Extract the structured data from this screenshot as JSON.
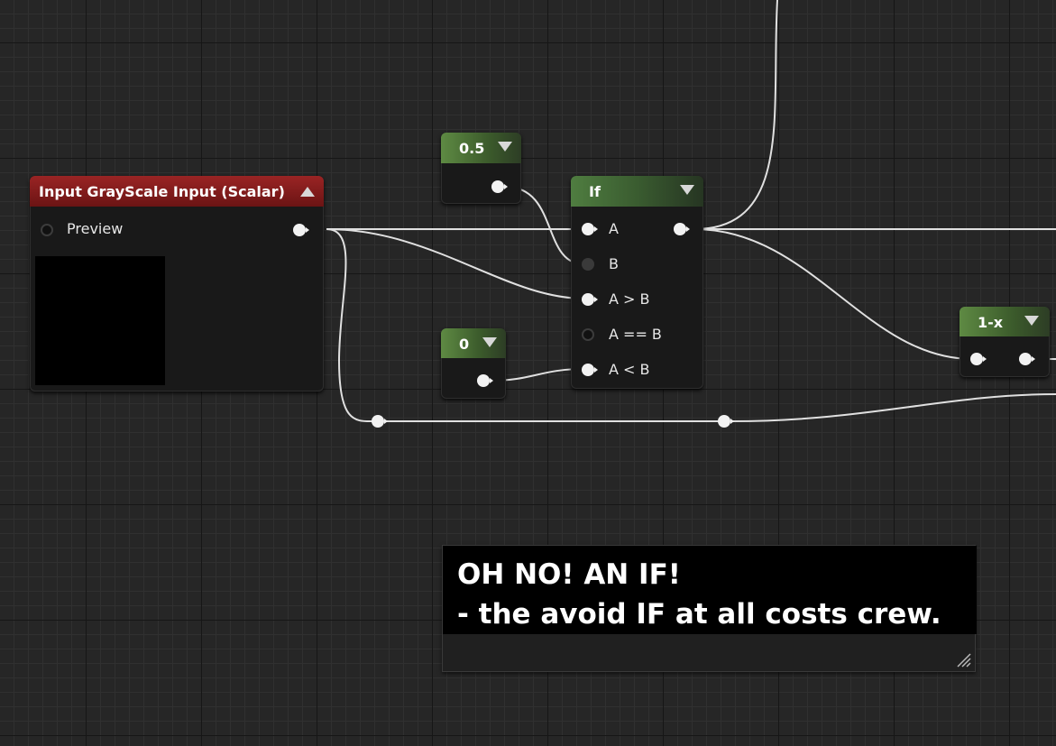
{
  "graph": {
    "background": "#262626",
    "wire_color": "#e0e0e0"
  },
  "nodes": {
    "input": {
      "title": "Input GrayScale Input (Scalar)",
      "header_color": "#8a1f1f",
      "preview_label": "Preview"
    },
    "const_half": {
      "value": "0.5",
      "header_color": "#5e8a43"
    },
    "const_zero": {
      "value": "0",
      "header_color": "#5e8a43"
    },
    "if_node": {
      "title": "If",
      "header_color": "#4f7d40",
      "inputs": [
        "A",
        "B",
        "A > B",
        "A == B",
        "A < B"
      ]
    },
    "one_minus": {
      "title": "1-x",
      "header_color": "#5e8a43"
    }
  },
  "comment": {
    "line1": "OH NO! AN IF!",
    "line2": "- the avoid IF at all costs crew."
  },
  "icons": {
    "collapse": "triangle-up",
    "expand": "triangle-down",
    "pin": "circle-with-arrow"
  }
}
